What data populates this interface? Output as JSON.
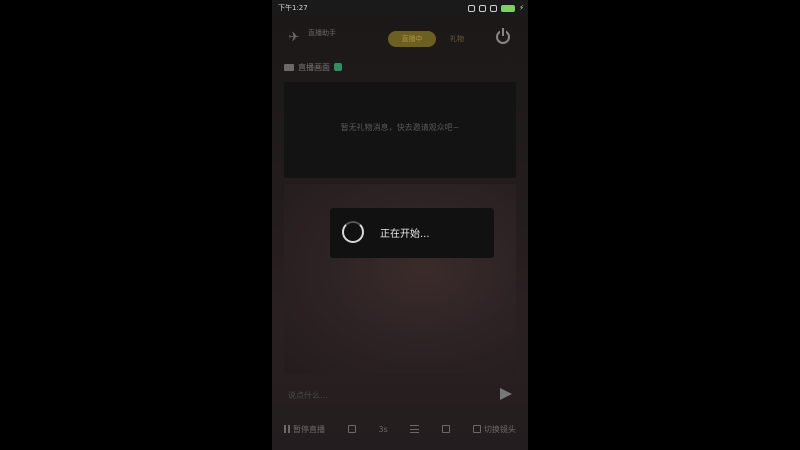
{
  "status_bar": {
    "time": "下午1:27"
  },
  "header": {
    "app_name": "直播助手",
    "tabs": [
      {
        "label": "直播中",
        "active": true
      },
      {
        "label": "礼物",
        "active": false
      }
    ]
  },
  "section": {
    "label": "直播画面"
  },
  "message_panel": {
    "text": "暂无礼物消息，快去邀请观众吧~"
  },
  "loading": {
    "text": "正在开始..."
  },
  "input": {
    "placeholder": "说点什么..."
  },
  "bottom_bar": {
    "items": [
      {
        "icon": "pause-icon",
        "label": "暂停直播"
      },
      {
        "icon": "screen-icon",
        "label": ""
      },
      {
        "icon": "beauty-icon",
        "label": "3s"
      },
      {
        "icon": "menu-icon",
        "label": ""
      },
      {
        "icon": "share-icon",
        "label": ""
      },
      {
        "icon": "flip-icon",
        "label": "切换镜头"
      }
    ]
  },
  "colors": {
    "active_tab": "#6c5f1f",
    "badge": "#2f8f5f",
    "battery": "#7ed05a"
  }
}
